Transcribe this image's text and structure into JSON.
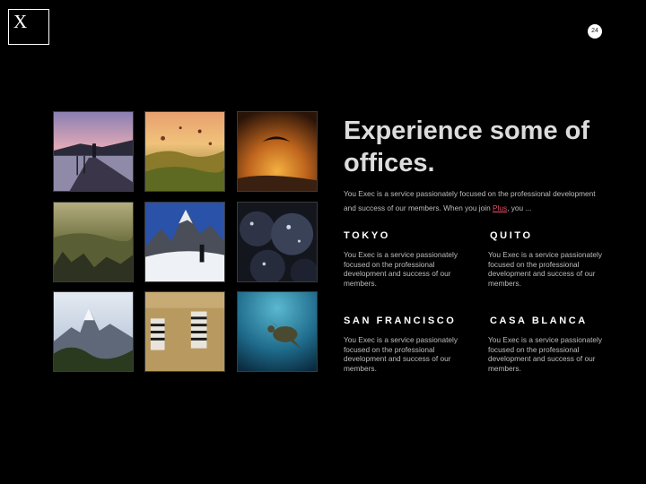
{
  "logo": {
    "letter": "X"
  },
  "page": {
    "number": "24"
  },
  "heading": {
    "title": "Experience some of offices."
  },
  "intro": {
    "text_before": "You Exec is a service passionately focused on the professional development and success of our members. When you join ",
    "link": "Plus",
    "text_after": ", you ..."
  },
  "cities": [
    {
      "name": "TOKYO",
      "description": "You Exec is a service passionately focused on the professional development and success of our members."
    },
    {
      "name": "QUITO",
      "description": "You Exec is a service passionately focused on the professional development and success of our members."
    },
    {
      "name": "SAN FRANCISCO",
      "description": "You Exec is a service passionately focused on the professional development and success of our members."
    },
    {
      "name": "CASA BLANCA",
      "description": "You Exec is a service passionately focused on the professional development and success of our members."
    }
  ],
  "colors": {
    "background": "#000000",
    "link": "#e8506a",
    "heading": "#dcdcdc"
  }
}
